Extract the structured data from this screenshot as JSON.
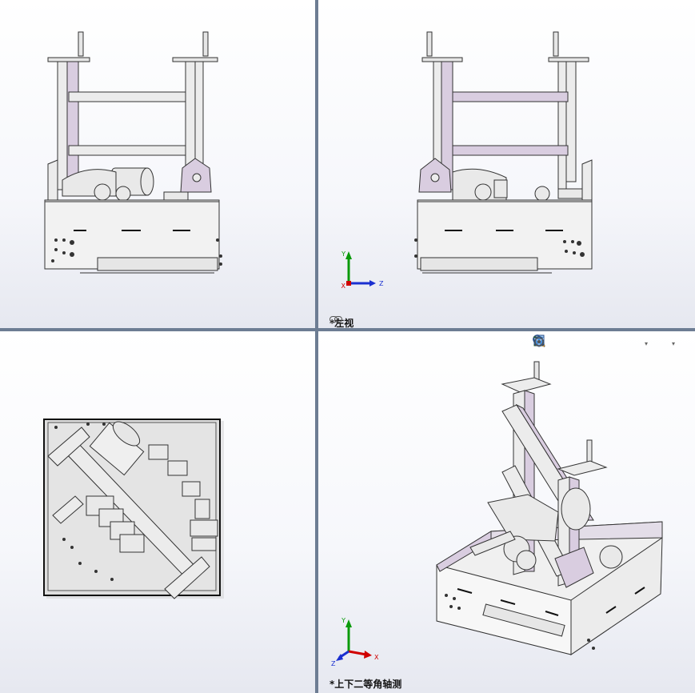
{
  "viewports": {
    "front": {
      "name": "front"
    },
    "left": {
      "label": "*左视"
    },
    "top": {
      "name": "top"
    },
    "iso": {
      "label": "*上下二等角轴测"
    }
  },
  "triad": {
    "x": "X",
    "y": "Y",
    "z": "Z"
  },
  "toolbar": {
    "icons": [
      "zoom-to-fit-icon",
      "zoom-to-area-icon",
      "previous-view-icon",
      "section-view-icon",
      "dynamic-annotation-icon",
      "view-orientation-icon",
      "display-style-icon",
      "hide-show-items-icon"
    ]
  },
  "colors": {
    "frame_purple": "#d9cde0",
    "steel_light": "#ececec",
    "line": "#333333",
    "separator": "#6d7d93",
    "axis_x": "#d00000",
    "axis_y": "#0a9a0a",
    "axis_z": "#1a2fd0"
  }
}
